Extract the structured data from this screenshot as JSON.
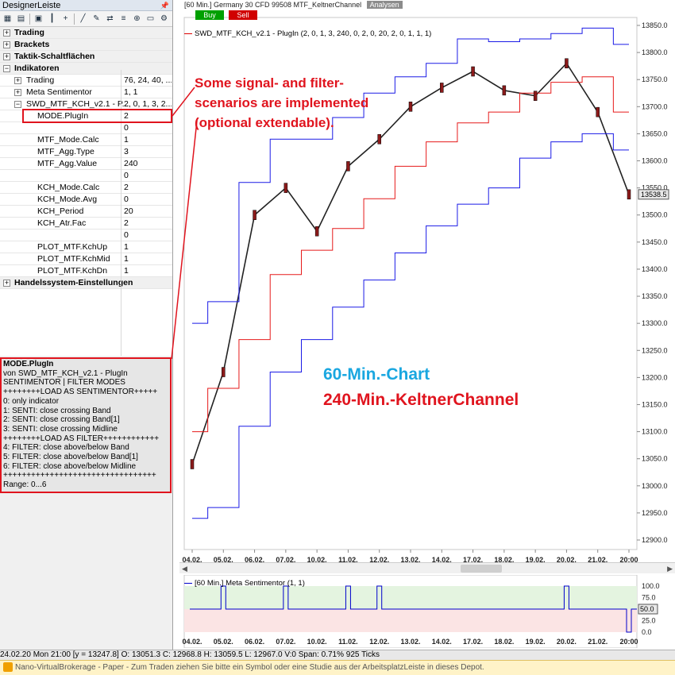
{
  "panel": {
    "title": "DesignerLeiste",
    "pin_icon": "pin-icon",
    "toolbar_icons": [
      "layout-icon",
      "folder-icon",
      "save-icon",
      "candle-icon",
      "add-icon",
      "line-icon",
      "draw-icon",
      "swap-icon",
      "bars-icon",
      "zoom-icon",
      "print-icon",
      "settings-icon",
      "expand-icon"
    ]
  },
  "tree": {
    "sections": {
      "trading": "Trading",
      "brackets": "Brackets",
      "taktik": "Taktik-Schaltflächen",
      "indikatoren": "Indikatoren",
      "handelssystem": "Handelssystem-Einstellungen"
    },
    "indicators": [
      {
        "label": "Trading",
        "value": "76, 24, 40, ..."
      },
      {
        "label": "Meta Sentimentor",
        "value": "1, 1"
      },
      {
        "label": "SWD_MTF_KCH_v2.1 - P...",
        "value": "2, 0, 1, 3, 2..."
      }
    ],
    "params": [
      {
        "label": "MODE.PlugIn",
        "value": "2"
      },
      {
        "label": "",
        "value": "0"
      },
      {
        "label": "MTF_Mode.Calc",
        "value": "1"
      },
      {
        "label": "MTF_Agg.Type",
        "value": "3"
      },
      {
        "label": "MTF_Agg.Value",
        "value": "240"
      },
      {
        "label": "",
        "value": "0"
      },
      {
        "label": "KCH_Mode.Calc",
        "value": "2"
      },
      {
        "label": "KCH_Mode.Avg",
        "value": "0"
      },
      {
        "label": "KCH_Period",
        "value": "20"
      },
      {
        "label": "KCH_Atr.Fac",
        "value": "2"
      },
      {
        "label": "",
        "value": "0"
      },
      {
        "label": "PLOT_MTF.KchUp",
        "value": "1"
      },
      {
        "label": "PLOT_MTF.KchMid",
        "value": "1"
      },
      {
        "label": "PLOT_MTF.KchDn",
        "value": "1"
      }
    ]
  },
  "help": {
    "title": "MODE.PlugIn",
    "lines": [
      "von SWD_MTF_KCH_v2.1 - PlugIn",
      "SENTIMENTOR | FILTER MODES",
      "++++++++LOAD AS SENTIMENTOR+++++",
      "0: only indicator",
      "1: SENTI: close crossing Band",
      "2: SENTI: close crossing Band[1]",
      "3: SENTI: close crossing Midline",
      "++++++++LOAD AS FILTER++++++++++++",
      "4: FILTER: close above/below Band",
      "5: FILTER: close above/below Band[1]",
      "6: FILTER: close above/below Midline",
      "+++++++++++++++++++++++++++++++++",
      "Range: 0...6"
    ]
  },
  "chart_header": {
    "text": "[60 Min.] Germany 30 CFD   99508 MTF_KeltnerChannel",
    "analysen": "Analysen",
    "buy": "Buy",
    "sell": "Sell",
    "legend": "SWD_MTF_KCH_v2.1 - PlugIn  (2, 0, 1, 3, 240, 0, 2, 0, 20, 2, 0, 1, 1, 1)",
    "price_tag": "13538.5"
  },
  "annotations": {
    "callout": "Some signal- and filter-scenarios are implemented (optional extendable).",
    "label_60": "60-Min.-Chart",
    "label_240": "240-Min.-KeltnerChannel"
  },
  "sub_chart": {
    "legend": "[60 Min.] Meta Sentimentor  (1, 1)",
    "value_tag": "50.0"
  },
  "statusbar": "24.02.20 Mon  21:00 [y = 13247.8]     O: 13051.3 C: 12968.8 H: 13059.5 L: 12967.0 V:0 Span: 0.71% 925 Ticks",
  "infobar": "Nano-VirtualBrokerage - Paper - Zum Traden ziehen Sie bitte ein Symbol oder eine Studie aus der ArbeitsplatzLeiste in dieses Depot.",
  "colors": {
    "kch_up": "#1a1ae6",
    "kch_mid": "#e61a1a",
    "highlight": "#e0141e",
    "senti": "#0000cc"
  },
  "chart_data": [
    {
      "type": "line",
      "title": "",
      "x_ticks": [
        "04.02.",
        "05.02.",
        "06.02.",
        "07.02.",
        "10.02.",
        "11.02.",
        "12.02.",
        "13.02.",
        "14.02.",
        "17.02.",
        "18.02.",
        "19.02.",
        "20.02.",
        "21.02.",
        "20:00"
      ],
      "ylim": [
        12900,
        13850
      ],
      "y_ticks": [
        12900,
        12950,
        13000,
        13050,
        13100,
        13150,
        13200,
        13250,
        13300,
        13350,
        13400,
        13450,
        13500,
        13550,
        13600,
        13650,
        13700,
        13750,
        13800,
        13850
      ],
      "x": [
        0,
        1,
        2,
        3,
        4,
        5,
        6,
        7,
        8,
        9,
        10,
        11,
        12,
        13,
        14
      ],
      "series": [
        {
          "name": "",
          "values": [
            13040,
            13210,
            13500,
            13550,
            13470,
            13590,
            13640,
            13700,
            13735,
            13765,
            13730,
            13720,
            13780,
            13690,
            13538
          ]
        },
        {
          "name": "",
          "values": [
            13300,
            13340,
            13560,
            13640,
            13640,
            13680,
            13725,
            13755,
            13780,
            13825,
            13820,
            13825,
            13835,
            13845,
            13815
          ]
        },
        {
          "name": "",
          "values": [
            13100,
            13180,
            13270,
            13390,
            13435,
            13475,
            13530,
            13590,
            13635,
            13670,
            13690,
            13725,
            13745,
            13755,
            13690
          ]
        },
        {
          "name": "",
          "values": [
            12940,
            12960,
            13110,
            13210,
            13270,
            13330,
            13380,
            13430,
            13480,
            13520,
            13550,
            13605,
            13635,
            13650,
            13620
          ]
        }
      ]
    },
    {
      "type": "line",
      "title": "",
      "ylim": [
        0,
        100
      ],
      "y_ticks": [
        "100.0",
        "75.0",
        "50.0",
        "25.0",
        "0.0"
      ],
      "x_ticks": [
        "04.02.",
        "05.02.",
        "06.02.",
        "07.02.",
        "10.02.",
        "11.02.",
        "12.02.",
        "13.02.",
        "14.02.",
        "17.02.",
        "18.02.",
        "19.02.",
        "20.02.",
        "21.02.",
        "20:00"
      ],
      "x": [
        0,
        1,
        2,
        3,
        4,
        5,
        6,
        7,
        8,
        9,
        10,
        11,
        12,
        13,
        14
      ],
      "series": [
        {
          "name": "",
          "values": [
            50,
            100,
            50,
            100,
            50,
            100,
            100,
            50,
            50,
            50,
            50,
            50,
            100,
            50,
            0
          ]
        }
      ]
    }
  ]
}
